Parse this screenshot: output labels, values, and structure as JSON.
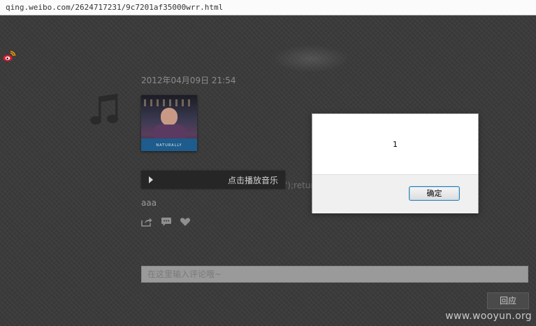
{
  "browser": {
    "url": "qing.weibo.com/2624717231/9c7201af35000wrr.html"
  },
  "post": {
    "date": "2012年04月09日 21:54",
    "album_caption": "NATURALLY",
    "player_label": "点击播放音乐",
    "injected_text": "');retur",
    "text": "aaa"
  },
  "icons": {
    "logo": "weibo-logo-icon",
    "music": "music-note-icon",
    "play": "play-icon",
    "share": "share-icon",
    "comment": "comment-icon",
    "like": "heart-icon"
  },
  "comment_box": {
    "placeholder": "在这里输入评论哦~"
  },
  "reply_button": {
    "label": "回应"
  },
  "alert": {
    "message": "1",
    "ok_label": "确定"
  },
  "watermark": "www.wooyun.org",
  "colors": {
    "accent_weibo": "#e6162d",
    "page_bg": "#3b3b3b",
    "dialog_border": "#3c7fb1"
  }
}
